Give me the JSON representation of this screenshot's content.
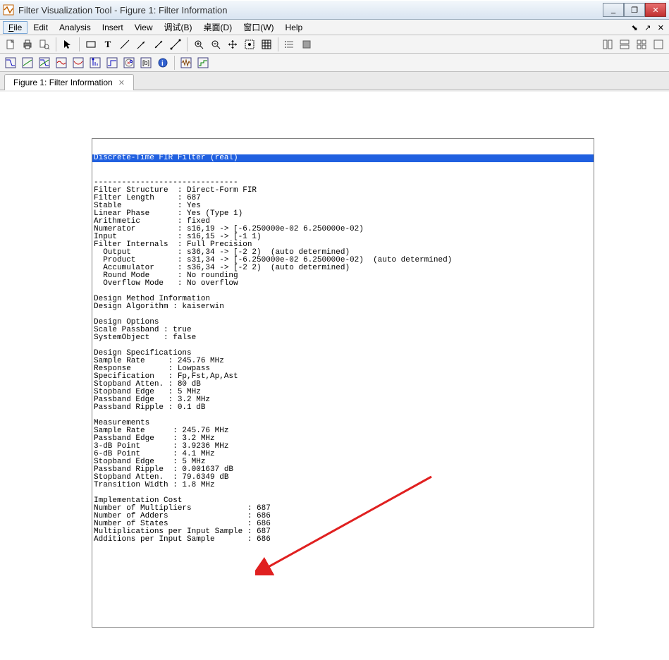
{
  "window": {
    "title": "Filter Visualization Tool - Figure 1: Filter Information",
    "min": "_",
    "max": "❐",
    "close": "✕"
  },
  "menu": {
    "file": "File",
    "edit": "Edit",
    "analysis": "Analysis",
    "insert": "Insert",
    "view": "View",
    "debug": "调试(B)",
    "desktop": "桌面(D)",
    "window": "窗口(W)",
    "help": "Help",
    "right_pin": "⬊",
    "right_undock": "↗",
    "right_close": "✕"
  },
  "tabs": {
    "tab1": "Figure 1: Filter Information",
    "tab1_close": "✕"
  },
  "toolbar1_icons": {
    "new": "new-doc-icon",
    "print": "print-icon",
    "preview": "print-preview-icon",
    "cursor": "cursor-icon",
    "rect": "rect-icon",
    "text": "text-icon",
    "line1": "line-icon",
    "line2": "line2-icon",
    "arrow": "arrow-icon",
    "doublearrow": "doublearrow-icon",
    "zoomin": "zoom-in-icon",
    "zoomout": "zoom-out-icon",
    "pan": "pan-icon",
    "fit": "fit-icon",
    "grid": "grid-icon",
    "list": "list-icon",
    "shade": "shade-icon",
    "layout1": "layout1-icon",
    "layout2": "layout2-icon",
    "layout3": "layout3-icon",
    "layout4": "layout4-icon"
  },
  "toolbar2_icons": {
    "mag": "magnitude-icon",
    "phase": "phase-icon",
    "group": "groupdelay-icon",
    "impulse": "impulse-icon",
    "step": "step-icon",
    "pz": "polezero-icon",
    "up": "up-arrow-icon",
    "square": "square-icon",
    "coef": "coef-icon",
    "freq": "freq-icon",
    "info": "info-icon",
    "noise": "noise-icon",
    "round": "round-icon"
  },
  "text": {
    "header": "Discrete-Time FIR Filter (real)                                                                                          ",
    "body": "-------------------------------\nFilter Structure  : Direct-Form FIR\nFilter Length     : 687\nStable            : Yes\nLinear Phase      : Yes (Type 1)\nArithmetic        : fixed\nNumerator         : s16,19 -> [-6.250000e-02 6.250000e-02)\nInput             : s16,15 -> [-1 1)\nFilter Internals  : Full Precision\n  Output          : s36,34 -> [-2 2)  (auto determined)\n  Product         : s31,34 -> [-6.250000e-02 6.250000e-02)  (auto determined)\n  Accumulator     : s36,34 -> [-2 2)  (auto determined)\n  Round Mode      : No rounding\n  Overflow Mode   : No overflow\n\nDesign Method Information\nDesign Algorithm : kaiserwin\n\nDesign Options\nScale Passband : true\nSystemObject   : false\n\nDesign Specifications\nSample Rate     : 245.76 MHz\nResponse        : Lowpass\nSpecification   : Fp,Fst,Ap,Ast\nStopband Atten. : 80 dB\nStopband Edge   : 5 MHz\nPassband Edge   : 3.2 MHz\nPassband Ripple : 0.1 dB\n\nMeasurements\nSample Rate      : 245.76 MHz\nPassband Edge    : 3.2 MHz\n3-dB Point       : 3.9236 MHz\n6-dB Point       : 4.1 MHz\nStopband Edge    : 5 MHz\nPassband Ripple  : 0.001637 dB\nStopband Atten.  : 79.6349 dB\nTransition Width : 1.8 MHz\n\nImplementation Cost\nNumber of Multipliers            : 687\nNumber of Adders                 : 686\nNumber of States                 : 686\nMultiplications per Input Sample : 687\nAdditions per Input Sample       : 686\n"
  }
}
